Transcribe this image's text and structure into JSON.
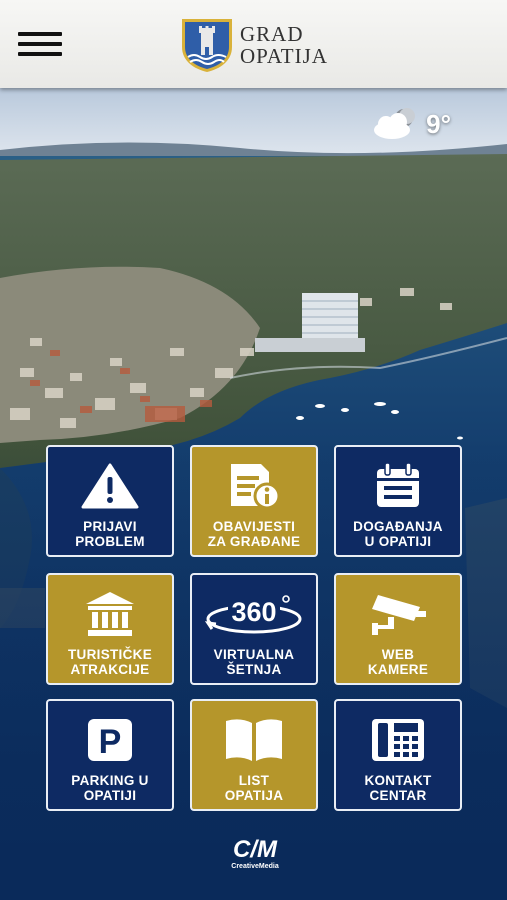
{
  "header": {
    "title_line1": "GRAD",
    "title_line2": "OPATIJA",
    "menu_icon": "hamburger-menu-icon",
    "crest_icon": "opatija-coat-of-arms"
  },
  "weather": {
    "temperature": "9°",
    "icon": "cloudy-moon-icon"
  },
  "tiles": [
    {
      "line1": "PRIJAVI",
      "line2": "PROBLEM",
      "icon": "warning-triangle-icon",
      "color": "#0e2a63"
    },
    {
      "line1": "OBAVIJESTI",
      "line2": "ZA GRAĐANE",
      "icon": "document-info-icon",
      "color": "#b5962b"
    },
    {
      "line1": "DOGAĐANJA",
      "line2": "U OPATIJI",
      "icon": "calendar-icon",
      "color": "#0e2a63"
    },
    {
      "line1": "TURISTIČKE",
      "line2": "ATRAKCIJE",
      "icon": "museum-building-icon",
      "color": "#b5962b"
    },
    {
      "line1": "VIRTUALNA",
      "line2": "ŠETNJA",
      "icon": "360-view-icon",
      "icon_text": "360",
      "color": "#0e2a63"
    },
    {
      "line1": "WEB",
      "line2": "KAMERE",
      "icon": "security-camera-icon",
      "color": "#b5962b"
    },
    {
      "line1": "PARKING U",
      "line2": "OPATIJI",
      "icon": "parking-icon",
      "icon_text": "P",
      "color": "#0e2a63"
    },
    {
      "line1": "LIST",
      "line2": "OPATIJA",
      "icon": "open-book-icon",
      "color": "#b5962b"
    },
    {
      "line1": "KONTAKT",
      "line2": "CENTAR",
      "icon": "phone-fax-icon",
      "color": "#0e2a63"
    }
  ],
  "footer": {
    "logo_text": "C/M",
    "logo_subtext": "CreativeMedia"
  }
}
